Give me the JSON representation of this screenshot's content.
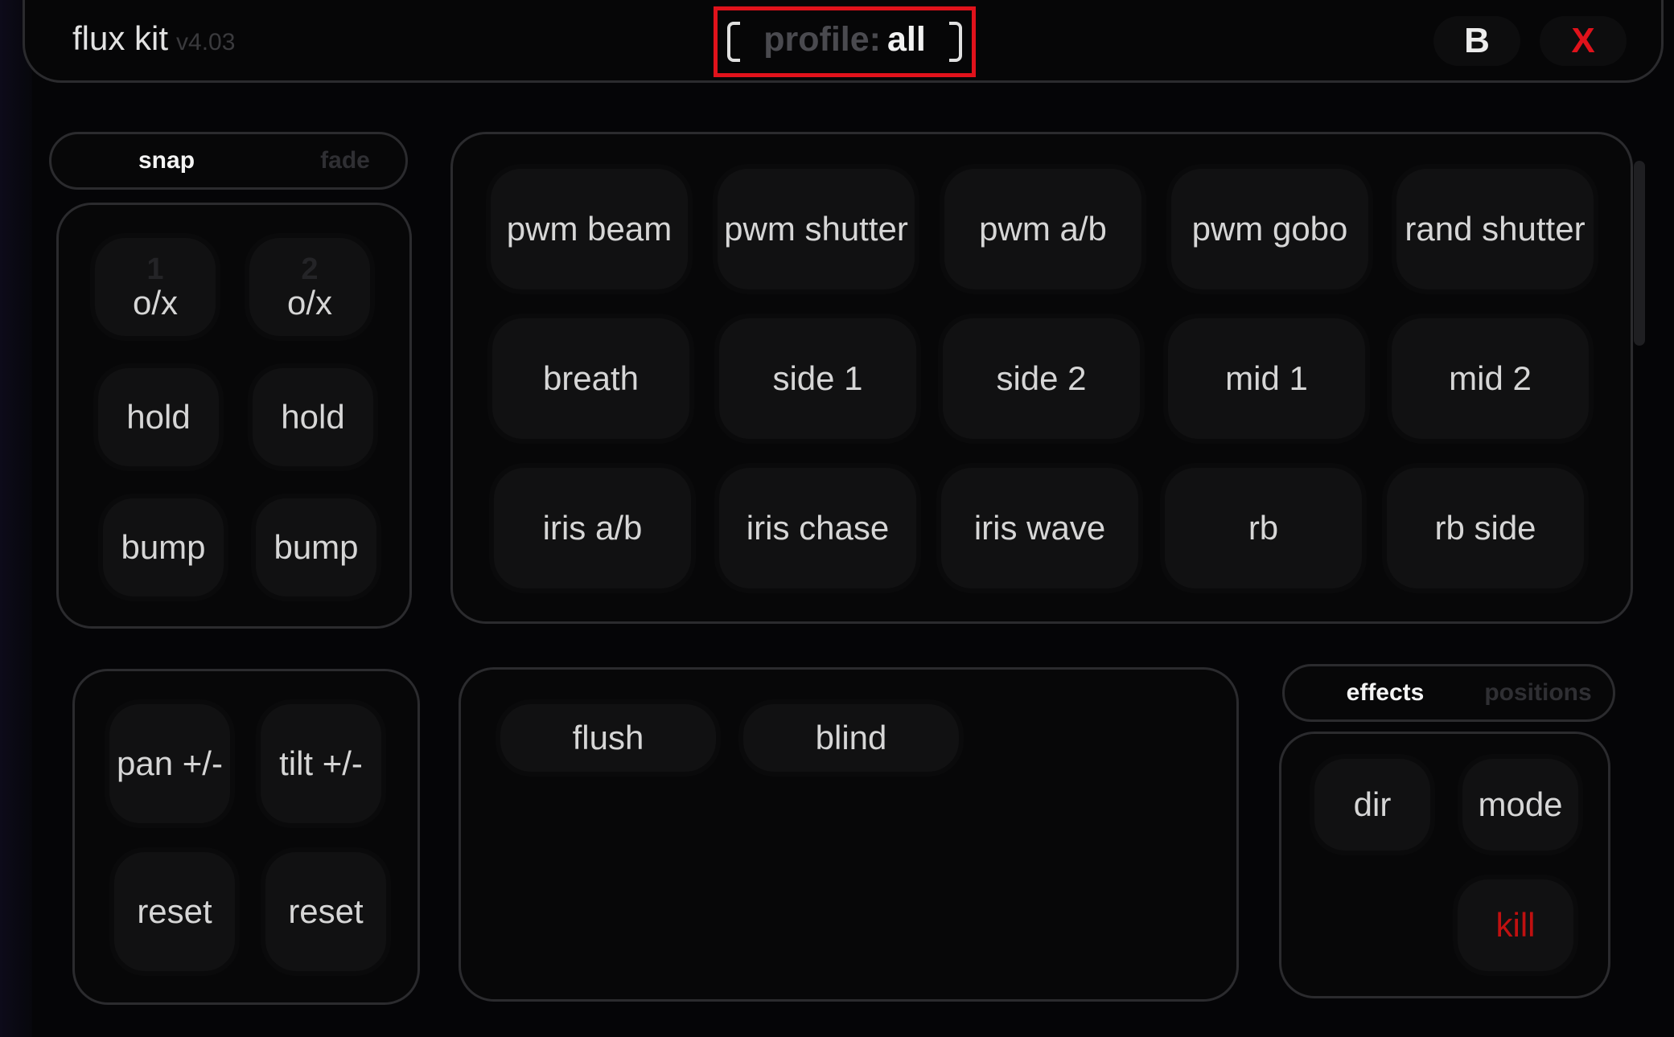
{
  "app": {
    "title": "flux kit",
    "version": "v4.03"
  },
  "profile": {
    "label": "profile:",
    "value": "all",
    "highlight_color": "#e0121b"
  },
  "window_buttons": {
    "b_label": "B",
    "close_label": "X",
    "close_color": "#e0121b"
  },
  "transition_toggle": {
    "options": [
      "snap",
      "fade"
    ],
    "selected": "snap"
  },
  "playback": {
    "slots": [
      {
        "number": "1",
        "toggle_label": "o/x",
        "hold_label": "hold",
        "bump_label": "bump"
      },
      {
        "number": "2",
        "toggle_label": "o/x",
        "hold_label": "hold",
        "bump_label": "bump"
      }
    ]
  },
  "effects_grid": {
    "rows": [
      [
        "pwm beam",
        "pwm shutter",
        "pwm a/b",
        "pwm gobo",
        "rand shutter"
      ],
      [
        "breath",
        "side 1",
        "side 2",
        "mid 1",
        "mid 2"
      ],
      [
        "iris a/b",
        "iris chase",
        "iris wave",
        "rb",
        "rb side"
      ]
    ]
  },
  "position_controls": {
    "pan_label": "pan +/-",
    "tilt_label": "tilt +/-",
    "reset_pan_label": "reset",
    "reset_tilt_label": "reset"
  },
  "specials": {
    "buttons": [
      "flush",
      "blind"
    ]
  },
  "mode_toggle": {
    "options": [
      "effects",
      "positions"
    ],
    "selected": "effects"
  },
  "effect_controls": {
    "dir_label": "dir",
    "mode_label": "mode",
    "kill_label": "kill",
    "kill_color": "#c01010"
  }
}
